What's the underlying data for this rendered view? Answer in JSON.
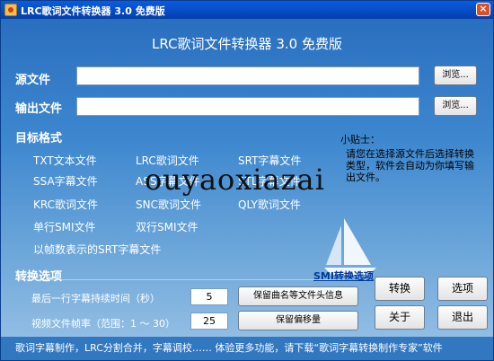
{
  "window": {
    "title": "LRC歌词文件转换器 3.0 免费版",
    "close": "×"
  },
  "header": {
    "title": "LRC歌词文件转换器 3.0 免费版"
  },
  "source": {
    "label": "源文件",
    "value": "",
    "browse": "浏览..."
  },
  "output": {
    "label": "输出文件",
    "value": "",
    "browse": "浏览..."
  },
  "target": {
    "label": "目标格式",
    "formats": [
      "TXT文本文件",
      "LRC歌词文件",
      "SRT字幕文件",
      "SSA字幕文件",
      "ASS字幕文件",
      "STL字幕文件",
      "KRC歌词文件",
      "SNC歌词文件",
      "QLY歌词文件",
      "单行SMI文件",
      "双行SMI文件",
      "以帧数表示的SRT字幕文件"
    ]
  },
  "tips": {
    "title": "小贴士：",
    "text": "请您在选择源文件后选择转换类型，软件会自动为你填写输出文件。"
  },
  "options": {
    "label": "转换选项",
    "smi_link": "SMI转换选项",
    "last_line_label": "最后一行字幕持续时间（秒）",
    "last_line_value": "5",
    "framerate_label": "视频文件帧率（范围：1 ～ 30）",
    "framerate_value": "25",
    "keep_header_button": "保留曲名等文件头信息",
    "keep_offset_button": "保留偏移量"
  },
  "actions": {
    "convert": "转换",
    "options": "选项",
    "about": "关于",
    "exit": "退出"
  },
  "status": {
    "text": "歌词字幕制作，LRC分割合并，字幕调校…… 体验更多功能，请下载“歌词字幕转换制作专家”软件"
  },
  "watermark": "ouyaoxiazai"
}
